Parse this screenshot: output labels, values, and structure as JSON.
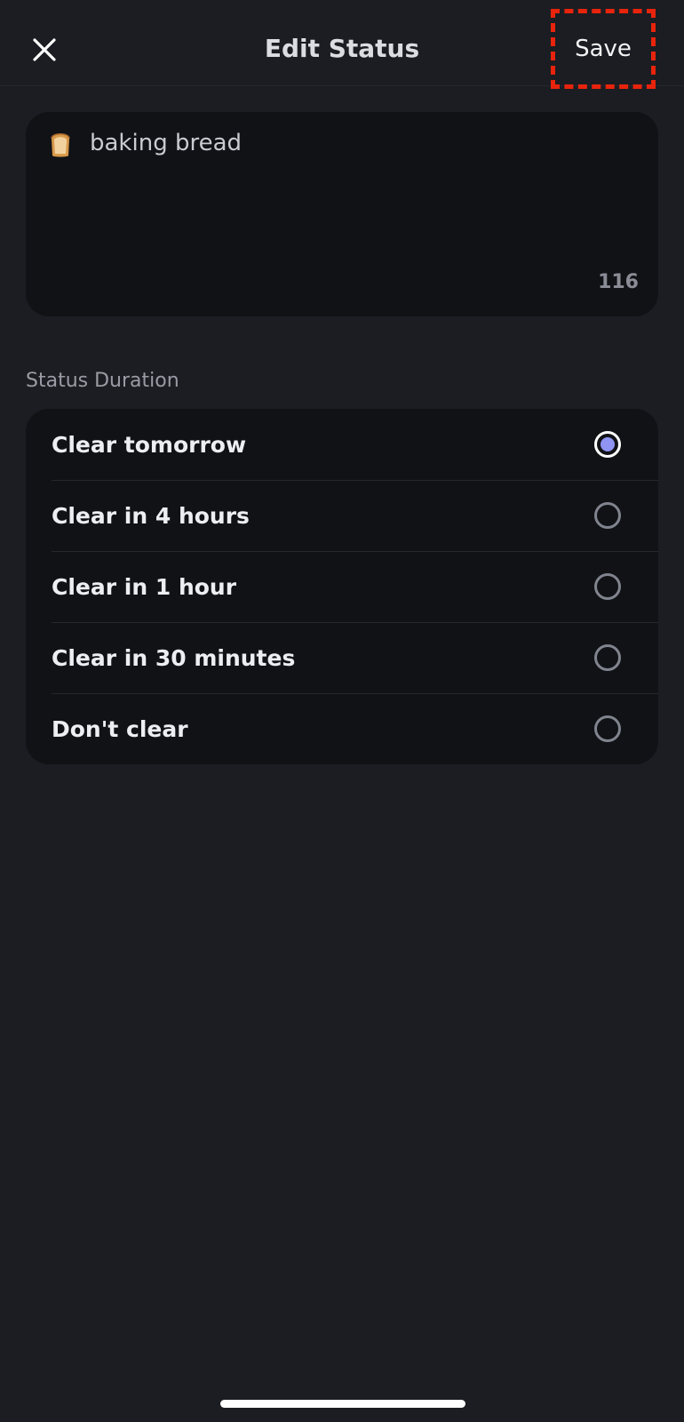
{
  "header": {
    "title": "Edit Status",
    "save_label": "Save",
    "close_icon": "close-icon"
  },
  "status": {
    "emoji": "bread-emoji",
    "text": "baking bread",
    "char_count": "116"
  },
  "duration": {
    "label": "Status Duration",
    "options": [
      {
        "label": "Clear tomorrow",
        "selected": true
      },
      {
        "label": "Clear in 4 hours",
        "selected": false
      },
      {
        "label": "Clear in 1 hour",
        "selected": false
      },
      {
        "label": "Clear in 30 minutes",
        "selected": false
      },
      {
        "label": "Don't clear",
        "selected": false
      }
    ]
  },
  "colors": {
    "background": "#1c1d22",
    "card": "#111216",
    "accent": "#8f93f2",
    "highlight": "#e8240c"
  }
}
